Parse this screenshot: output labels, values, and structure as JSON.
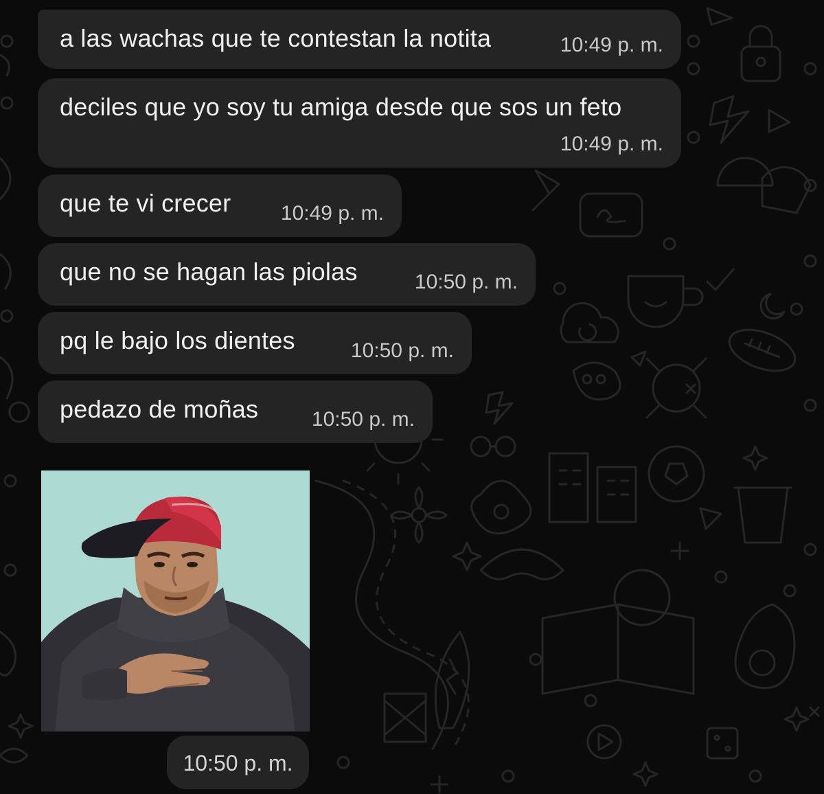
{
  "chat": {
    "messages": [
      {
        "text": "a las wachas que te contestan la notita",
        "time": "10:49 p. m."
      },
      {
        "text": "deciles que yo soy tu amiga desde que sos un feto",
        "time": "10:49 p. m."
      },
      {
        "text": "que te vi crecer",
        "time": "10:49 p. m."
      },
      {
        "text": "que no se hagan las piolas",
        "time": "10:50 p. m."
      },
      {
        "text": "pq le bajo los dientes",
        "time": "10:50 p. m."
      },
      {
        "text": "pedazo de moñas",
        "time": "10:50 p. m."
      }
    ],
    "photo_message": {
      "time": "10:50 p. m."
    }
  },
  "colors": {
    "wallpaper": "#0b0b0b",
    "bubble": "#242424",
    "text": "#f0f0f0",
    "timestamp": "#c9c9c9"
  }
}
